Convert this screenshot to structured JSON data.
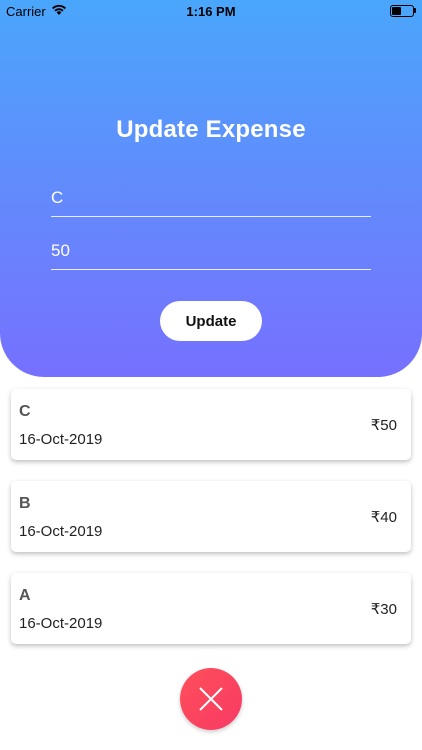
{
  "status_bar": {
    "carrier": "Carrier",
    "time": "1:16 PM",
    "wifi_icon": "wifi-icon",
    "battery_icon": "battery-icon"
  },
  "form": {
    "title": "Update Expense",
    "name_value": "C",
    "amount_value": "50",
    "update_label": "Update"
  },
  "expenses": [
    {
      "name": "C",
      "date": "16-Oct-2019",
      "amount": "₹50"
    },
    {
      "name": "B",
      "date": "16-Oct-2019",
      "amount": "₹40"
    },
    {
      "name": "A",
      "date": "16-Oct-2019",
      "amount": "₹30"
    }
  ],
  "fab": {
    "icon": "close-icon",
    "color": "#fd4760"
  },
  "colors": {
    "gradient_top": "#4aa6fb",
    "gradient_bottom": "#7670fe"
  }
}
